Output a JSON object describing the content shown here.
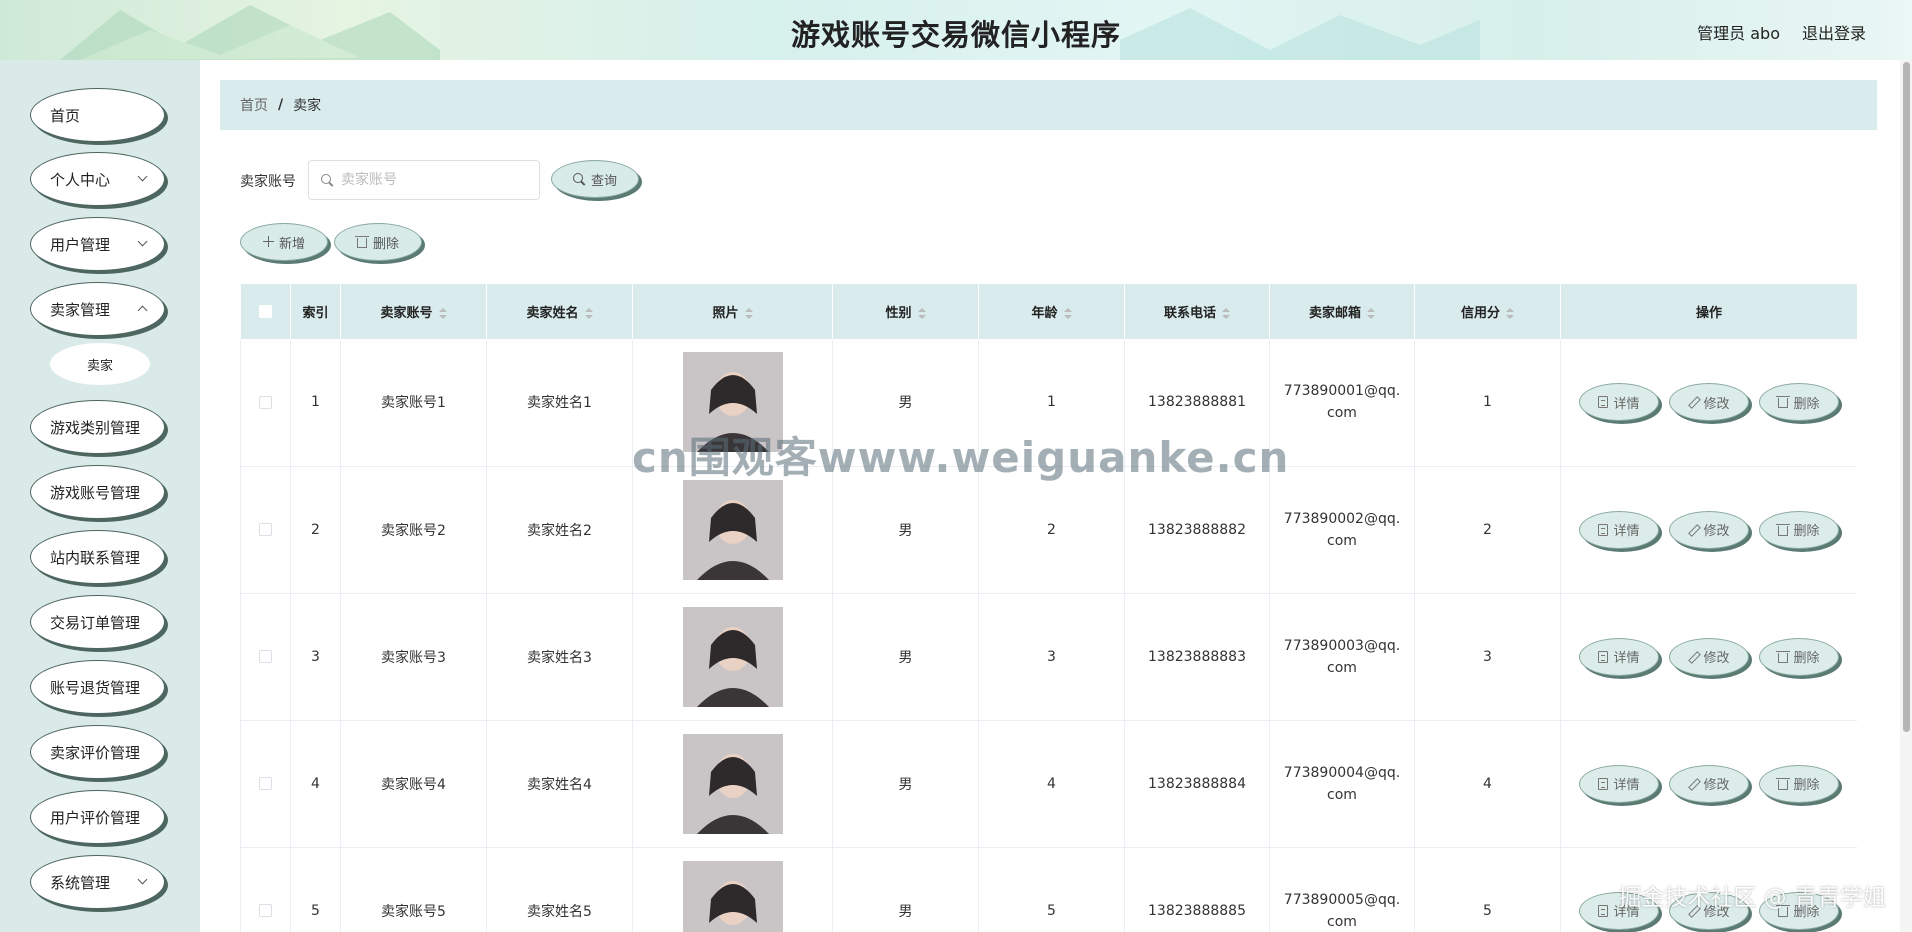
{
  "header": {
    "title": "游戏账号交易微信小程序",
    "user_label": "管理员 abo",
    "logout_label": "退出登录"
  },
  "sidebar": {
    "items": [
      {
        "label": "首页",
        "has_children": false
      },
      {
        "label": "个人中心",
        "has_children": true
      },
      {
        "label": "用户管理",
        "has_children": true
      },
      {
        "label": "卖家管理",
        "has_children": true
      },
      {
        "label": "游戏类别管理",
        "has_children": false
      },
      {
        "label": "游戏账号管理",
        "has_children": false
      },
      {
        "label": "站内联系管理",
        "has_children": false
      },
      {
        "label": "交易订单管理",
        "has_children": false
      },
      {
        "label": "账号退货管理",
        "has_children": false
      },
      {
        "label": "卖家评价管理",
        "has_children": false
      },
      {
        "label": "用户评价管理",
        "has_children": false
      },
      {
        "label": "系统管理",
        "has_children": true
      }
    ],
    "submenu_item": "卖家"
  },
  "breadcrumb": {
    "home": "首页",
    "separator": "/",
    "current": "卖家"
  },
  "search": {
    "label": "卖家账号",
    "placeholder": "卖家账号",
    "value": "",
    "query_button": "查询"
  },
  "toolbar": {
    "add_label": "新增",
    "delete_label": "删除"
  },
  "table": {
    "columns": [
      "索引",
      "卖家账号",
      "卖家姓名",
      "照片",
      "性别",
      "年龄",
      "联系电话",
      "卖家邮箱",
      "信用分",
      "操作"
    ],
    "actions": {
      "detail": "详情",
      "edit": "修改",
      "delete": "删除"
    },
    "rows": [
      {
        "index": "1",
        "account": "卖家账号1",
        "name": "卖家姓名1",
        "gender": "男",
        "age": "1",
        "phone": "13823888881",
        "email": "773890001@qq.com",
        "credit": "1"
      },
      {
        "index": "2",
        "account": "卖家账号2",
        "name": "卖家姓名2",
        "gender": "男",
        "age": "2",
        "phone": "13823888882",
        "email": "773890002@qq.com",
        "credit": "2"
      },
      {
        "index": "3",
        "account": "卖家账号3",
        "name": "卖家姓名3",
        "gender": "男",
        "age": "3",
        "phone": "13823888883",
        "email": "773890003@qq.com",
        "credit": "3"
      },
      {
        "index": "4",
        "account": "卖家账号4",
        "name": "卖家姓名4",
        "gender": "男",
        "age": "4",
        "phone": "13823888884",
        "email": "773890004@qq.com",
        "credit": "4"
      },
      {
        "index": "5",
        "account": "卖家账号5",
        "name": "卖家姓名5",
        "gender": "男",
        "age": "5",
        "phone": "13823888885",
        "email": "773890005@qq.com",
        "credit": "5"
      }
    ]
  },
  "watermarks": {
    "center": "cn围观客www.weiguanke.cn",
    "corner": "掘金技术社区 @ 青青学姐"
  },
  "colors": {
    "accent": "#d9ebec",
    "sidebar_bg": "#daeae9",
    "button_shadow": "#5a7a72"
  }
}
